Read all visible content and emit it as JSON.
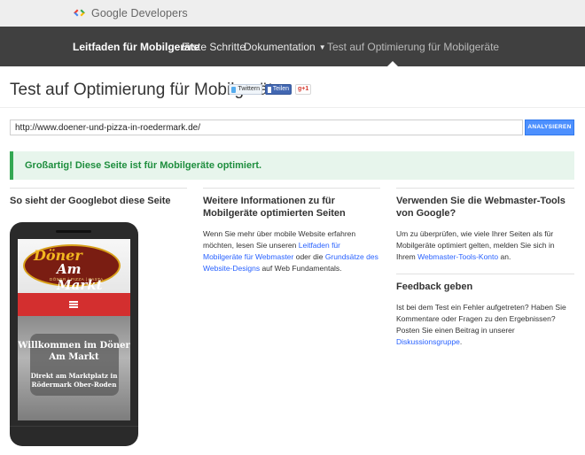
{
  "brand": {
    "name": "Google Developers"
  },
  "nav": {
    "items": [
      {
        "label": "Leitfaden für Mobilgeräte"
      },
      {
        "label": "Erste Schritte"
      },
      {
        "label": "Dokumentation"
      },
      {
        "label": "Test auf Optimierung für Mobilgeräte"
      }
    ]
  },
  "page": {
    "title": "Test auf Optimierung für Mobilgeräte",
    "share": {
      "twitter": "Twittern",
      "facebook": "Teilen",
      "gplus": "g+1"
    }
  },
  "form": {
    "url_value": "http://www.doener-und-pizza-in-roedermark.de/",
    "analyze_label": "ANALYSIEREN"
  },
  "result": {
    "message": "Großartig! Diese Seite ist für Mobilgeräte optimiert."
  },
  "col1": {
    "heading": "So sieht der Googlebot diese Seite",
    "phone": {
      "logo_line1": "Döner",
      "logo_line2": "Am Markt",
      "logo_line3": "DÖNER | PIZZA | PASTA",
      "welcome": "Willkommen im Döner Am Markt",
      "address": "Direkt am Marktplatz in Rödermark Ober-Roden"
    }
  },
  "col2": {
    "heading": "Weitere Informationen zu für Mobilgeräte optimierten Seiten",
    "text1": "Wenn Sie mehr über mobile Website erfahren möchten, lesen Sie unseren ",
    "link1": "Leitfaden für Mobilgeräte für Webmaster",
    "text2": " oder die ",
    "link2": "Grundsätze des Website-Designs",
    "text3": " auf Web Fundamentals."
  },
  "col3": {
    "heading": "Verwenden Sie die Webmaster-Tools von Google?",
    "text1": "Um zu überprüfen, wie viele Ihrer Seiten als für Mobilgeräte optimiert gelten, melden Sie sich in Ihrem ",
    "link1": "Webmaster-Tools-Konto",
    "text2": " an.",
    "feedback_heading": "Feedback geben",
    "feedback_text1": "Ist bei dem Test ein Fehler aufgetreten? Haben Sie Kommentare oder Fragen zu den Ergebnissen? Posten Sie einen Beitrag in unserer ",
    "feedback_link": "Diskussionsgruppe",
    "feedback_text2": "."
  },
  "colors": {
    "nav_bg": "#404040",
    "brand_bar_bg": "#eeeeee",
    "button_blue": "#4d90fe",
    "success_green": "#1e8e3e",
    "link_blue": "#2962ff"
  }
}
